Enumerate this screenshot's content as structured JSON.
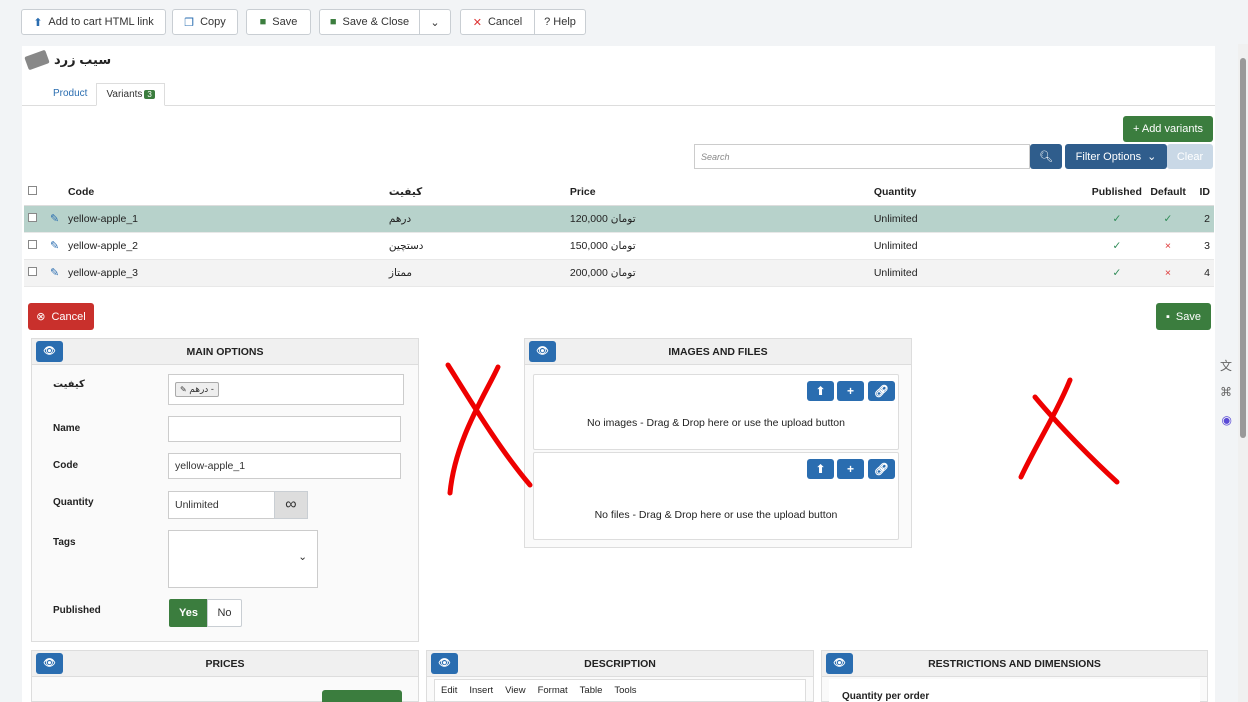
{
  "toolbar": {
    "add_to_cart": "Add to cart HTML link",
    "copy": "Copy",
    "save": "Save",
    "save_close": "Save & Close",
    "cancel": "Cancel",
    "help": "? Help"
  },
  "product": {
    "title": "سیب زرد"
  },
  "tabs": [
    {
      "label": "Product"
    },
    {
      "label": "Variants",
      "badge": "3"
    }
  ],
  "actions": {
    "add_variants": "+ Add variants",
    "search_placeholder": "Search",
    "filter_options": "Filter Options",
    "clear": "Clear"
  },
  "table": {
    "headers": {
      "code": "Code",
      "quality": "کیفیت",
      "price": "Price",
      "quantity": "Quantity",
      "published": "Published",
      "default": "Default",
      "id": "ID"
    },
    "rows": [
      {
        "code": "yellow-apple_1",
        "quality": "درهم",
        "price": "120,000 تومان",
        "quantity": "Unlimited",
        "published": "✓",
        "default": "✓",
        "id": "2"
      },
      {
        "code": "yellow-apple_2",
        "quality": "دستچین",
        "price": "150,000 تومان",
        "quantity": "Unlimited",
        "published": "✓",
        "default": "×",
        "id": "3"
      },
      {
        "code": "yellow-apple_3",
        "quality": "ممتاز",
        "price": "200,000 تومان",
        "quantity": "Unlimited",
        "published": "✓",
        "default": "×",
        "id": "4"
      }
    ]
  },
  "edit": {
    "cancel": "Cancel",
    "save": "Save"
  },
  "main_options": {
    "title": "MAIN OPTIONS",
    "quality_label": "کیفیت",
    "quality_value": "درهم -",
    "name_label": "Name",
    "name_value": "",
    "code_label": "Code",
    "code_value": "yellow-apple_1",
    "quantity_label": "Quantity",
    "quantity_value": "Unlimited",
    "tags_label": "Tags",
    "published_label": "Published",
    "yes": "Yes",
    "no": "No"
  },
  "images_files": {
    "title": "IMAGES AND FILES",
    "no_images": "No images - Drag & Drop here or use the upload button",
    "no_files": "No files - Drag & Drop here or use the upload button"
  },
  "prices": {
    "title": "PRICES"
  },
  "description": {
    "title": "DESCRIPTION",
    "menu": [
      "Edit",
      "Insert",
      "View",
      "Format",
      "Table",
      "Tools"
    ]
  },
  "restrictions": {
    "title": "RESTRICTIONS AND DIMENSIONS",
    "quantity_per_order": "Quantity per order"
  }
}
